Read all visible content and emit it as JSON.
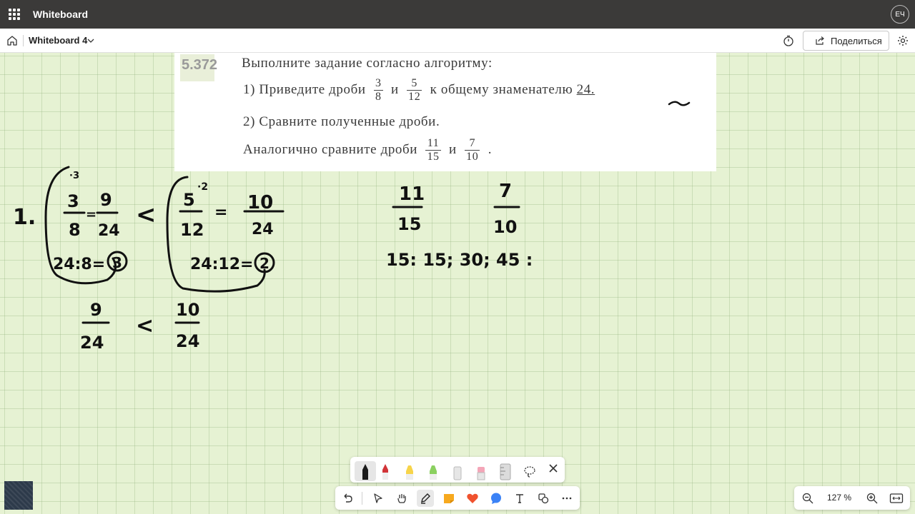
{
  "titlebar": {
    "app_name": "Whiteboard",
    "avatar_initials": "ЕЧ"
  },
  "commandbar": {
    "board_title": "Whiteboard 4",
    "share_label": "Поделиться"
  },
  "problem": {
    "number": "5.372",
    "line1": "Выполните задание согласно алгоритму:",
    "line2_prefix": "1) Приведите дроби",
    "frac1": {
      "num": "3",
      "den": "8"
    },
    "line2_and": "и",
    "frac2": {
      "num": "5",
      "den": "12"
    },
    "line2_suffix": "к общему знаменателю",
    "line2_value": "24.",
    "line3": "2) Сравните полученные дроби.",
    "line4_prefix": "Аналогично сравните дроби",
    "frac3": {
      "num": "11",
      "den": "15"
    },
    "line4_and": "и",
    "frac4": {
      "num": "7",
      "den": "10"
    },
    "line4_end": "."
  },
  "handwriting": {
    "item_number": "1.",
    "a_factor": "·3",
    "a_frac_num": "3",
    "a_frac_den": "8",
    "a_eq": "=",
    "a_res_num": "9",
    "a_res_den": "24",
    "a_calc": "24:8=",
    "a_calc_result": "3",
    "compare1": "<",
    "b_factor": "·2",
    "b_frac_num": "5",
    "b_frac_den": "12",
    "b_eq": "=",
    "b_res_num": "10",
    "b_res_den": "24",
    "b_calc": "24:12=",
    "b_calc_result": "2",
    "c_num": "9",
    "c_den": "24",
    "compare2": "<",
    "d_num": "10",
    "d_den": "24",
    "e_num": "11",
    "e_den": "15",
    "f_num": "7",
    "f_den": "10",
    "multiples": "15: 15; 30; 45 :"
  },
  "pens": [
    {
      "name": "black-pen",
      "color": "#1a1a1a"
    },
    {
      "name": "red-pen",
      "color": "#d13438"
    },
    {
      "name": "yellow-highlighter",
      "color": "#f7d44a"
    },
    {
      "name": "green-highlighter",
      "color": "#8bd060"
    },
    {
      "name": "white-eraser",
      "color": "#e0e0e0"
    },
    {
      "name": "pink-eraser",
      "color": "#f4a6b8"
    },
    {
      "name": "ruler",
      "color": "#cfcfcf"
    }
  ],
  "zoom": {
    "level": "127 %"
  }
}
